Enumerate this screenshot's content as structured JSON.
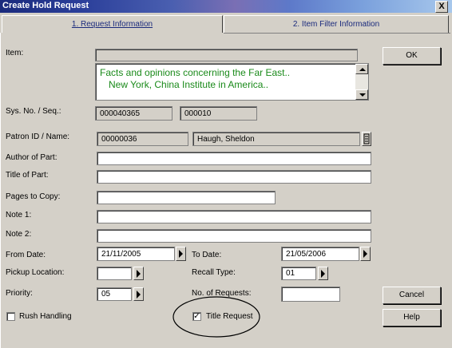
{
  "window": {
    "title": "Create Hold Request",
    "close_glyph": "X"
  },
  "tabs": [
    {
      "label": "1. Request Information"
    },
    {
      "label": "2. Item Filter Information"
    }
  ],
  "form": {
    "item": {
      "label": "Item:",
      "bar_value": "",
      "lines": [
        "Facts and opinions concerning the Far East..",
        "New York, China Institute in America.."
      ]
    },
    "sys_no": {
      "label": "Sys. No. / Seq.:",
      "sys": "000040365",
      "seq": "000010"
    },
    "patron": {
      "label": "Patron ID / Name:",
      "id": "00000036",
      "name": "Haugh, Sheldon"
    },
    "author_of_part": {
      "label": "Author of Part:",
      "value": ""
    },
    "title_of_part": {
      "label": "Title of Part:",
      "value": ""
    },
    "pages_to_copy": {
      "label": "Pages to Copy:",
      "value": ""
    },
    "note1": {
      "label": "Note 1:",
      "value": ""
    },
    "note2": {
      "label": "Note 2:",
      "value": ""
    },
    "from_date": {
      "label": "From Date:",
      "value": "21/11/2005"
    },
    "to_date": {
      "label": "To Date:",
      "value": "21/05/2006"
    },
    "pickup_location": {
      "label": "Pickup Location:",
      "value": ""
    },
    "recall_type": {
      "label": "Recall Type:",
      "value": "01"
    },
    "priority": {
      "label": "Priority:",
      "value": "05"
    },
    "no_of_requests": {
      "label": "No. of Requests:",
      "value": ""
    },
    "rush_handling": {
      "label": "Rush Handling",
      "checked": false
    },
    "title_request": {
      "label": "Title Request",
      "checked": true,
      "check_glyph": "✓"
    }
  },
  "buttons": {
    "ok": "OK",
    "cancel": "Cancel",
    "help": "Help"
  }
}
